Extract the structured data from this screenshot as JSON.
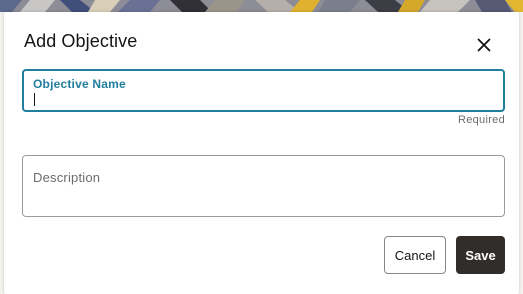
{
  "dialog": {
    "title": "Add Objective",
    "close_icon": "close-icon"
  },
  "fields": {
    "objective_name": {
      "label": "Objective Name",
      "value": "",
      "required_text": "Required"
    },
    "description": {
      "placeholder": "Description",
      "value": ""
    }
  },
  "actions": {
    "cancel_label": "Cancel",
    "save_label": "Save"
  },
  "colors": {
    "accent": "#227e9e",
    "primary_button": "#312d2a",
    "text": "#161513",
    "muted": "#6f6c69"
  }
}
